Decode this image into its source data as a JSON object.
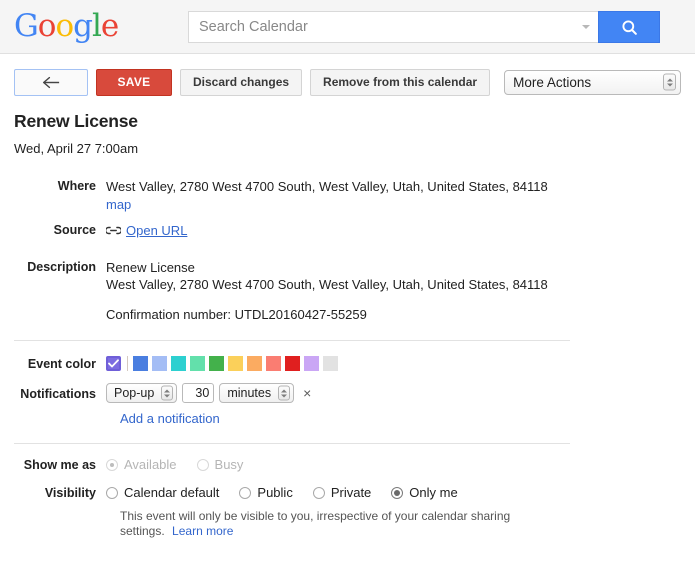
{
  "header": {
    "logo_text": "Google",
    "logo_letters": [
      {
        "ch": "G",
        "color": "#4285f4"
      },
      {
        "ch": "o",
        "color": "#ea4335"
      },
      {
        "ch": "o",
        "color": "#fbbc05"
      },
      {
        "ch": "g",
        "color": "#4285f4"
      },
      {
        "ch": "l",
        "color": "#34a853"
      },
      {
        "ch": "e",
        "color": "#ea4335"
      }
    ],
    "search_placeholder": "Search Calendar",
    "search_value": "",
    "search_icon": "search-icon",
    "search_button_color": "#4285f4"
  },
  "toolbar": {
    "back_label": "←",
    "save_label": "SAVE",
    "save_color": "#d84a3c",
    "discard_label": "Discard changes",
    "remove_label": "Remove from this calendar",
    "more_actions_label": "More Actions"
  },
  "event": {
    "title": "Renew License",
    "date": "Wed, April 27 7:00am"
  },
  "fields": {
    "where_label": "Where",
    "where_value": "West Valley, 2780 West 4700 South, West Valley, Utah, United States, 84118",
    "map_link": "map",
    "source_label": "Source",
    "source_link": "Open URL",
    "source_icon": "link-icon",
    "description_label": "Description",
    "description_line1": "Renew License",
    "description_line2": "West Valley, 2780 West 4700 South, West Valley, Utah, United States, 84118",
    "description_line3": "Confirmation number: UTDL20160427-55259"
  },
  "event_color": {
    "label": "Event color",
    "selected_checkbox": true,
    "selected_color": "#7c6ce0",
    "swatches": [
      {
        "name": "blue",
        "hex": "#4a7ee0"
      },
      {
        "name": "light-blue",
        "hex": "#a4bdf5"
      },
      {
        "name": "cyan",
        "hex": "#2dd0d0"
      },
      {
        "name": "mint",
        "hex": "#63e0ab"
      },
      {
        "name": "green",
        "hex": "#43b14b"
      },
      {
        "name": "yellow",
        "hex": "#fbd05a"
      },
      {
        "name": "orange",
        "hex": "#fbab61"
      },
      {
        "name": "salmon",
        "hex": "#fa7d72"
      },
      {
        "name": "red",
        "hex": "#e01f1f"
      },
      {
        "name": "lavender",
        "hex": "#caa6f5"
      },
      {
        "name": "gray",
        "hex": "#e2e2e2"
      }
    ]
  },
  "notifications": {
    "label": "Notifications",
    "method": "Pop-up",
    "amount": "30",
    "unit": "minutes",
    "remove_icon": "×",
    "add_link": "Add a notification"
  },
  "show_me_as": {
    "label": "Show me as",
    "disabled": true,
    "options": [
      {
        "label": "Available",
        "selected": true
      },
      {
        "label": "Busy",
        "selected": false
      }
    ]
  },
  "visibility": {
    "label": "Visibility",
    "options": [
      {
        "label": "Calendar default",
        "selected": false
      },
      {
        "label": "Public",
        "selected": false
      },
      {
        "label": "Private",
        "selected": false
      },
      {
        "label": "Only me",
        "selected": true
      }
    ],
    "note": "This event will only be visible to you, irrespective of your calendar sharing settings.",
    "learn_more": "Learn more"
  }
}
